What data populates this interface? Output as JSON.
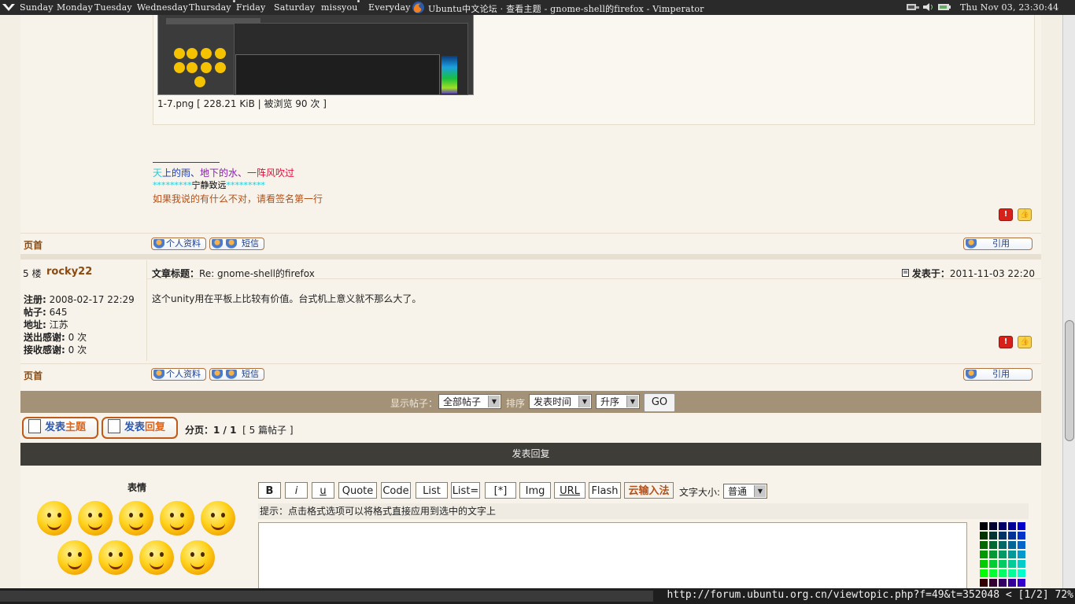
{
  "topbar": {
    "items": [
      "Sunday",
      "Monday",
      "Tuesday",
      "Wednesday",
      "Thursday",
      "Friday",
      "Saturday",
      "missyou",
      "Everyday"
    ],
    "window_title": "Ubuntu中文论坛 · 查看主题 - gnome-shell的firefox - Vimperator",
    "clock": "Thu Nov 03, 23:30:44"
  },
  "attachment": {
    "caption": "1-7.png [ 228.21 KiB | 被浏览 90 次 ]"
  },
  "signature": {
    "line1_parts": [
      "天",
      "上的雨、",
      "地下的水、",
      "一阵风吹过"
    ],
    "line2_left": "*********",
    "line2_mid": "宁静致远",
    "line2_right": "*********",
    "line3": "如果我说的有什么不对，请看签名第一行"
  },
  "post_actions": {
    "home": "页首",
    "profile": "个人资料",
    "pm": "短信",
    "quote": "引用",
    "report_icon": "!",
    "thanks_icon": "👍"
  },
  "post5": {
    "floor": "5 楼",
    "author": "rocky22",
    "subject_label": "文章标题：",
    "subject": "Re: gnome-shell的firefox",
    "posted_label": "发表于：",
    "posted": "2011-11-03 22:20",
    "body": "这个unity用在平板上比较有价值。台式机上意义就不那么大了。",
    "meta": [
      {
        "label": "注册:",
        "value": "2008-02-17 22:29"
      },
      {
        "label": "帖子:",
        "value": "645"
      },
      {
        "label": "地址:",
        "value": "江苏"
      },
      {
        "label": "送出感谢:",
        "value": "0 次"
      },
      {
        "label": "接收感谢:",
        "value": "0 次"
      }
    ]
  },
  "filter": {
    "show_label": "显示帖子：",
    "show_value": "全部帖子",
    "sort_label": "排序",
    "sort_value": "发表时间",
    "order_value": "升序",
    "go": "GO"
  },
  "buttons": {
    "new_topic_a": "发表",
    "new_topic_b": "主题",
    "reply_a": "发表",
    "reply_b": "回复"
  },
  "pagination": {
    "label": "分页：",
    "value": "1 / 1",
    "count": "[ 5 篇帖子 ]"
  },
  "reply_section": {
    "title": "发表回复",
    "smilies_title": "表情",
    "format_buttons": [
      "B",
      "i",
      "u",
      "Quote",
      "Code",
      "List",
      "List=",
      "[*]",
      "Img",
      "URL",
      "Flash",
      "云输入法"
    ],
    "font_size_label": "文字大小:",
    "font_size_value": "普通",
    "hint": "提示：点击格式选项可以将格式直接应用到选中的文字上"
  },
  "statusbar": {
    "url": "http://forum.ubuntu.org.cn/viewtopic.php?f=49&t=352048 < [1/2] 72%"
  },
  "colors": {
    "accent": "#8a4a10",
    "filterbar": "#a39278",
    "replybar": "#3e3d37"
  }
}
